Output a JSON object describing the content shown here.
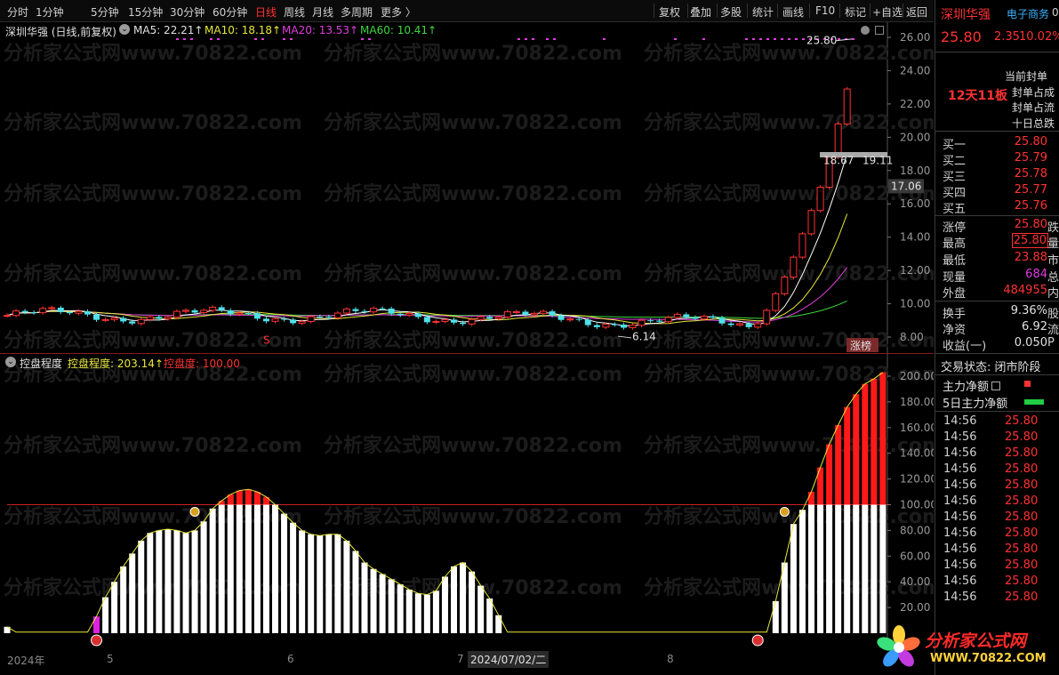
{
  "toolbar": {
    "periods": [
      "分时",
      "1分钟",
      "5分钟",
      "15分钟",
      "30分钟",
      "60分钟",
      "日线",
      "周线",
      "月线",
      "多周期",
      "更多 〉"
    ],
    "tools": [
      "复权",
      "叠加",
      "多股",
      "统计",
      "画线",
      "F10",
      "标记",
      "+自选",
      "返回"
    ]
  },
  "main_legend": {
    "title": "深圳华强 (日线,前复权)",
    "ma5": "MA5: 22.21↑",
    "ma10": "MA10: 18.18↑",
    "ma20": "MA20: 13.53↑",
    "ma60": "MA60: 10.41↑"
  },
  "main_axis": [
    "26.00",
    "24.00",
    "22.00",
    "20.00",
    "18.00",
    "16.00",
    "14.00",
    "12.00",
    "10.00",
    "8.00"
  ],
  "price_marker": "17.06",
  "annotations": {
    "high": "25.80",
    "gap_low": "18.67",
    "gap_high": "19.11",
    "low": "6.14",
    "zhangbang": "涨榜",
    "s_mark": "S"
  },
  "ind_legend": {
    "name": "控盘程度",
    "v1": "控盘程度: 203.14↑",
    "v2": "控盘度: 100.00"
  },
  "ind_axis": [
    "200.00",
    "180.00",
    "160.00",
    "140.00",
    "120.00",
    "100.00",
    "80.00",
    "60.00",
    "40.00",
    "20.00"
  ],
  "date_axis": {
    "year": "2024年",
    "m5": "5",
    "m6": "6",
    "m7": "7",
    "cursor": "2024/07/02/二",
    "m8": "8"
  },
  "watermark": "分析家公式网www.70822.com",
  "quote": {
    "name": "深圳华强",
    "category": "电子商务",
    "code_cut": "00(",
    "price": "25.80",
    "change": "2.35",
    "pct": "10.02%",
    "streak": "12天11板",
    "notes": [
      "当前封单",
      "封单占成",
      "封单占流",
      "十日总跌"
    ],
    "bids": [
      {
        "label": "买一",
        "price": "25.80"
      },
      {
        "label": "买二",
        "price": "25.79"
      },
      {
        "label": "买三",
        "price": "25.78"
      },
      {
        "label": "买四",
        "price": "25.77"
      },
      {
        "label": "买五",
        "price": "25.76"
      }
    ],
    "stats": [
      {
        "label": "涨停",
        "value": "25.80",
        "cut": "跌"
      },
      {
        "label": "最高",
        "value": "25.80",
        "cut": "量"
      },
      {
        "label": "最低",
        "value": "23.88",
        "cut": "市"
      },
      {
        "label": "现量",
        "value": "684",
        "cut": "总"
      },
      {
        "label": "外盘",
        "value": "484955",
        "cut": "内"
      }
    ],
    "stats2": [
      {
        "label": "换手",
        "value": "9.36%",
        "cut": "股"
      },
      {
        "label": "净资",
        "value": "6.92",
        "cut": "流"
      },
      {
        "label": "收益(一)",
        "value": "0.050",
        "cut": "P"
      }
    ],
    "trade_status": "交易状态: 闭市阶段",
    "main_net": "主力净额",
    "main_net_5d": "5日主力净额",
    "ticks": [
      {
        "t": "14:56",
        "p": "25.80"
      },
      {
        "t": "14:56",
        "p": "25.80"
      },
      {
        "t": "14:56",
        "p": "25.80"
      },
      {
        "t": "14:56",
        "p": "25.80"
      },
      {
        "t": "14:56",
        "p": "25.80"
      },
      {
        "t": "14:56",
        "p": "25.80"
      },
      {
        "t": "14:56",
        "p": "25.80"
      },
      {
        "t": "14:56",
        "p": "25.80"
      },
      {
        "t": "14:56",
        "p": "25.80"
      },
      {
        "t": "14:56",
        "p": "25.80"
      },
      {
        "t": "14:56",
        "p": "25.80"
      },
      {
        "t": "14:56",
        "p": "25.80"
      }
    ]
  },
  "logo": {
    "text": "分析家公式网",
    "url": "WWW.70822.COM"
  },
  "colors": {
    "up": "#ff3232",
    "down": "#4fe0e8",
    "ma5": "#ffffff",
    "ma10": "#e8e83a",
    "ma20": "#e03ce0",
    "ma60": "#3ed83e",
    "ind_bar": "#ffffff",
    "ind_over": "#ff1a1a"
  },
  "indicator": {
    "level": 100,
    "values": [
      5,
      0,
      0,
      0,
      0,
      0,
      0,
      0,
      0,
      0,
      13,
      28,
      40,
      52,
      62,
      72,
      78,
      80,
      81,
      80,
      78,
      80,
      87,
      97,
      103,
      108,
      111,
      112,
      110,
      106,
      100,
      93,
      86,
      80,
      77,
      76,
      77,
      77,
      72,
      64,
      55,
      50,
      46,
      42,
      38,
      34,
      31,
      30,
      33,
      44,
      52,
      55,
      48,
      37,
      27,
      14,
      0,
      0,
      0,
      0,
      0,
      0,
      0,
      0,
      0,
      0,
      0,
      0,
      0,
      0,
      0,
      0,
      0,
      0,
      0,
      0,
      0,
      0,
      0,
      0,
      0,
      0,
      0,
      0,
      0,
      0,
      25,
      55,
      85,
      96,
      110,
      129,
      147,
      162,
      176,
      186,
      194,
      198,
      203
    ],
    "magenta_index": [
      10,
      84
    ]
  }
}
